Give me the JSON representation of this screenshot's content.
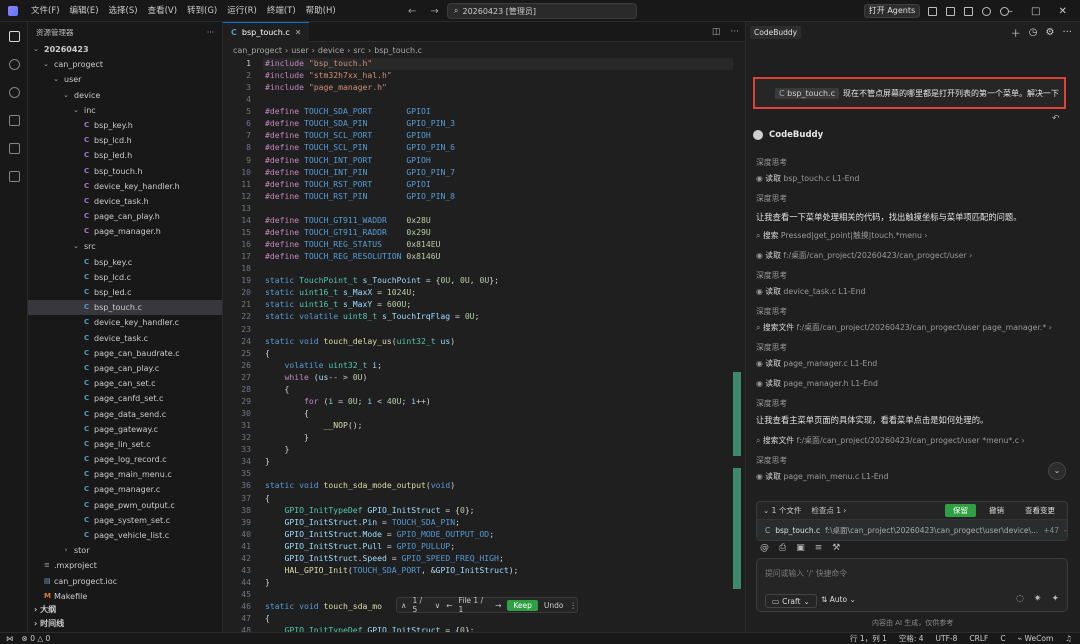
{
  "titlebar": {
    "menu": [
      "文件(F)",
      "编辑(E)",
      "选择(S)",
      "查看(V)",
      "转到(G)",
      "运行(R)",
      "终端(T)",
      "帮助(H)"
    ],
    "search": "20260423 [管理员]",
    "agents_button": "打开 Agents"
  },
  "explorer": {
    "title": "资源管理器",
    "more": "···",
    "tree": [
      {
        "label": "20260423",
        "depth": 0,
        "type": "folder-open",
        "bold": true
      },
      {
        "label": "can_progect",
        "depth": 1,
        "type": "folder-open"
      },
      {
        "label": "user",
        "depth": 2,
        "type": "folder-open"
      },
      {
        "label": "device",
        "depth": 3,
        "type": "folder-open"
      },
      {
        "label": "inc",
        "depth": 4,
        "type": "folder-open"
      },
      {
        "label": "bsp_key.h",
        "depth": 5,
        "type": "h"
      },
      {
        "label": "bsp_lcd.h",
        "depth": 5,
        "type": "h"
      },
      {
        "label": "bsp_led.h",
        "depth": 5,
        "type": "h"
      },
      {
        "label": "bsp_touch.h",
        "depth": 5,
        "type": "h"
      },
      {
        "label": "device_key_handler.h",
        "depth": 5,
        "type": "h"
      },
      {
        "label": "device_task.h",
        "depth": 5,
        "type": "h"
      },
      {
        "label": "page_can_play.h",
        "depth": 5,
        "type": "h"
      },
      {
        "label": "page_manager.h",
        "depth": 5,
        "type": "h"
      },
      {
        "label": "src",
        "depth": 4,
        "type": "folder-open"
      },
      {
        "label": "bsp_key.c",
        "depth": 5,
        "type": "c"
      },
      {
        "label": "bsp_lcd.c",
        "depth": 5,
        "type": "c"
      },
      {
        "label": "bsp_led.c",
        "depth": 5,
        "type": "c"
      },
      {
        "label": "bsp_touch.c",
        "depth": 5,
        "type": "c",
        "selected": true
      },
      {
        "label": "device_key_handler.c",
        "depth": 5,
        "type": "c"
      },
      {
        "label": "device_task.c",
        "depth": 5,
        "type": "c"
      },
      {
        "label": "page_can_baudrate.c",
        "depth": 5,
        "type": "c"
      },
      {
        "label": "page_can_play.c",
        "depth": 5,
        "type": "c"
      },
      {
        "label": "page_can_set.c",
        "depth": 5,
        "type": "c"
      },
      {
        "label": "page_canfd_set.c",
        "depth": 5,
        "type": "c"
      },
      {
        "label": "page_data_send.c",
        "depth": 5,
        "type": "c"
      },
      {
        "label": "page_gateway.c",
        "depth": 5,
        "type": "c"
      },
      {
        "label": "page_lin_set.c",
        "depth": 5,
        "type": "c"
      },
      {
        "label": "page_log_record.c",
        "depth": 5,
        "type": "c"
      },
      {
        "label": "page_main_menu.c",
        "depth": 5,
        "type": "c"
      },
      {
        "label": "page_manager.c",
        "depth": 5,
        "type": "c"
      },
      {
        "label": "page_pwm_output.c",
        "depth": 5,
        "type": "c"
      },
      {
        "label": "page_system_set.c",
        "depth": 5,
        "type": "c"
      },
      {
        "label": "page_vehicle_list.c",
        "depth": 5,
        "type": "c"
      },
      {
        "label": "stor",
        "depth": 3,
        "type": "folder-closed"
      },
      {
        "label": ".mxproject",
        "depth": 1,
        "type": "file"
      },
      {
        "label": "can_progect.ioc",
        "depth": 1,
        "type": "ioc"
      },
      {
        "label": "Makefile",
        "depth": 1,
        "type": "make"
      }
    ],
    "outline": "大纲",
    "timeline": "时间线"
  },
  "editor": {
    "tab": "bsp_touch.c",
    "breadcrumb": [
      "can_progect",
      "user",
      "device",
      "src",
      "bsp_touch.c"
    ],
    "lines": [
      [
        [
          "pp",
          "#include "
        ],
        [
          "str",
          "\"bsp_touch.h\""
        ]
      ],
      [
        [
          "pp",
          "#include "
        ],
        [
          "str",
          "\"stm32h7xx_hal.h\""
        ]
      ],
      [
        [
          "pp",
          "#include "
        ],
        [
          "str",
          "\"page_manager.h\""
        ]
      ],
      [],
      [
        [
          "pp",
          "#define "
        ],
        [
          "mac",
          "TOUCH_SDA_PORT       "
        ],
        [
          "mac",
          "GPIOI"
        ]
      ],
      [
        [
          "pp",
          "#define "
        ],
        [
          "mac",
          "TOUCH_SDA_PIN        "
        ],
        [
          "mac",
          "GPIO_PIN_3"
        ]
      ],
      [
        [
          "pp",
          "#define "
        ],
        [
          "mac",
          "TOUCH_SCL_PORT       "
        ],
        [
          "mac",
          "GPIOH"
        ]
      ],
      [
        [
          "pp",
          "#define "
        ],
        [
          "mac",
          "TOUCH_SCL_PIN        "
        ],
        [
          "mac",
          "GPIO_PIN_6"
        ]
      ],
      [
        [
          "pp",
          "#define "
        ],
        [
          "mac",
          "TOUCH_INT_PORT       "
        ],
        [
          "mac",
          "GPIOH"
        ]
      ],
      [
        [
          "pp",
          "#define "
        ],
        [
          "mac",
          "TOUCH_INT_PIN        "
        ],
        [
          "mac",
          "GPIO_PIN_7"
        ]
      ],
      [
        [
          "pp",
          "#define "
        ],
        [
          "mac",
          "TOUCH_RST_PORT       "
        ],
        [
          "mac",
          "GPIOI"
        ]
      ],
      [
        [
          "pp",
          "#define "
        ],
        [
          "mac",
          "TOUCH_RST_PIN        "
        ],
        [
          "mac",
          "GPIO_PIN_8"
        ]
      ],
      [],
      [
        [
          "pp",
          "#define "
        ],
        [
          "mac",
          "TOUCH_GT911_WADDR    "
        ],
        [
          "num",
          "0x28U"
        ]
      ],
      [
        [
          "pp",
          "#define "
        ],
        [
          "mac",
          "TOUCH_GT911_RADDR    "
        ],
        [
          "num",
          "0x29U"
        ]
      ],
      [
        [
          "pp",
          "#define "
        ],
        [
          "mac",
          "TOUCH_REG_STATUS     "
        ],
        [
          "num",
          "0x814EU"
        ]
      ],
      [
        [
          "pp",
          "#define "
        ],
        [
          "mac",
          "TOUCH_REG_RESOLUTION "
        ],
        [
          "num",
          "0x8146U"
        ]
      ],
      [],
      [
        [
          "kw",
          "static "
        ],
        [
          "ty",
          "TouchPoint_t "
        ],
        [
          "var",
          "s_TouchPoint"
        ],
        [
          "op",
          " = {"
        ],
        [
          "num",
          "0U"
        ],
        [
          "op",
          ", "
        ],
        [
          "num",
          "0U"
        ],
        [
          "op",
          ", "
        ],
        [
          "num",
          "0U"
        ],
        [
          "op",
          "};"
        ]
      ],
      [
        [
          "kw",
          "static "
        ],
        [
          "ty",
          "uint16_t "
        ],
        [
          "var",
          "s_MaxX"
        ],
        [
          "op",
          " = "
        ],
        [
          "num",
          "1024U"
        ],
        [
          "op",
          ";"
        ]
      ],
      [
        [
          "kw",
          "static "
        ],
        [
          "ty",
          "uint16_t "
        ],
        [
          "var",
          "s_MaxY"
        ],
        [
          "op",
          " = "
        ],
        [
          "num",
          "600U"
        ],
        [
          "op",
          ";"
        ]
      ],
      [
        [
          "kw",
          "static volatile "
        ],
        [
          "ty",
          "uint8_t "
        ],
        [
          "var",
          "s_TouchIrqFlag"
        ],
        [
          "op",
          " = "
        ],
        [
          "num",
          "0U"
        ],
        [
          "op",
          ";"
        ]
      ],
      [],
      [
        [
          "kw",
          "static void "
        ],
        [
          "fn",
          "touch_delay_us"
        ],
        [
          "op",
          "("
        ],
        [
          "ty",
          "uint32_t "
        ],
        [
          "var",
          "us"
        ],
        [
          "op",
          ")"
        ]
      ],
      [
        [
          "op",
          "{"
        ]
      ],
      [
        [
          "op",
          "    "
        ],
        [
          "kw",
          "volatile "
        ],
        [
          "ty",
          "uint32_t "
        ],
        [
          "var",
          "i"
        ],
        [
          "op",
          ";"
        ]
      ],
      [
        [
          "op",
          "    "
        ],
        [
          "pp",
          "while "
        ],
        [
          "op",
          "("
        ],
        [
          "var",
          "us"
        ],
        [
          "op",
          "-- > "
        ],
        [
          "num",
          "0U"
        ],
        [
          "op",
          ")"
        ]
      ],
      [
        [
          "op",
          "    {"
        ]
      ],
      [
        [
          "op",
          "        "
        ],
        [
          "pp",
          "for "
        ],
        [
          "op",
          "("
        ],
        [
          "var",
          "i"
        ],
        [
          "op",
          " = "
        ],
        [
          "num",
          "0U"
        ],
        [
          "op",
          "; "
        ],
        [
          "var",
          "i"
        ],
        [
          "op",
          " < "
        ],
        [
          "num",
          "40U"
        ],
        [
          "op",
          "; "
        ],
        [
          "var",
          "i"
        ],
        [
          "op",
          "++)"
        ]
      ],
      [
        [
          "op",
          "        {"
        ]
      ],
      [
        [
          "op",
          "            "
        ],
        [
          "fn",
          "__NOP"
        ],
        [
          "op",
          "();"
        ]
      ],
      [
        [
          "op",
          "        }"
        ]
      ],
      [
        [
          "op",
          "    }"
        ]
      ],
      [
        [
          "op",
          "}"
        ]
      ],
      [],
      [
        [
          "kw",
          "static void "
        ],
        [
          "fn",
          "touch_sda_mode_output"
        ],
        [
          "op",
          "("
        ],
        [
          "kw",
          "void"
        ],
        [
          "op",
          ")"
        ]
      ],
      [
        [
          "op",
          "{"
        ]
      ],
      [
        [
          "op",
          "    "
        ],
        [
          "ty",
          "GPIO_InitTypeDef "
        ],
        [
          "var",
          "GPIO_InitStruct"
        ],
        [
          "op",
          " = {"
        ],
        [
          "num",
          "0"
        ],
        [
          "op",
          "};"
        ]
      ],
      [
        [
          "op",
          "    "
        ],
        [
          "var",
          "GPIO_InitStruct"
        ],
        [
          "op",
          "."
        ],
        [
          "var",
          "Pin"
        ],
        [
          "op",
          " = "
        ],
        [
          "mac",
          "TOUCH_SDA_PIN"
        ],
        [
          "op",
          ";"
        ]
      ],
      [
        [
          "op",
          "    "
        ],
        [
          "var",
          "GPIO_InitStruct"
        ],
        [
          "op",
          "."
        ],
        [
          "var",
          "Mode"
        ],
        [
          "op",
          " = "
        ],
        [
          "mac",
          "GPIO_MODE_OUTPUT_OD"
        ],
        [
          "op",
          ";"
        ]
      ],
      [
        [
          "op",
          "    "
        ],
        [
          "var",
          "GPIO_InitStruct"
        ],
        [
          "op",
          "."
        ],
        [
          "var",
          "Pull"
        ],
        [
          "op",
          " = "
        ],
        [
          "mac",
          "GPIO_PULLUP"
        ],
        [
          "op",
          ";"
        ]
      ],
      [
        [
          "op",
          "    "
        ],
        [
          "var",
          "GPIO_InitStruct"
        ],
        [
          "op",
          "."
        ],
        [
          "var",
          "Speed"
        ],
        [
          "op",
          " = "
        ],
        [
          "mac",
          "GPIO_SPEED_FREQ_HIGH"
        ],
        [
          "op",
          ";"
        ]
      ],
      [
        [
          "op",
          "    "
        ],
        [
          "fn",
          "HAL_GPIO_Init"
        ],
        [
          "op",
          "("
        ],
        [
          "mac",
          "TOUCH_SDA_PORT"
        ],
        [
          "op",
          ", &"
        ],
        [
          "var",
          "GPIO_InitStruct"
        ],
        [
          "op",
          ");"
        ]
      ],
      [
        [
          "op",
          "}"
        ]
      ],
      [],
      [
        [
          "kw",
          "static void "
        ],
        [
          "fn",
          "touch_sda_mo"
        ]
      ],
      [
        [
          "op",
          "{"
        ]
      ],
      [
        [
          "op",
          "    "
        ],
        [
          "ty",
          "GPIO_InitTypeDef "
        ],
        [
          "var",
          "GPIO_InitStruct"
        ],
        [
          "op",
          " = {"
        ],
        [
          "num",
          "0"
        ],
        [
          "op",
          "};"
        ]
      ]
    ],
    "inline_actions": {
      "counter": "1 / 5",
      "file": "File 1 / 1",
      "keep": "Keep",
      "undo": "Undo"
    }
  },
  "chat": {
    "panel_title": "CodeBuddy",
    "user_file_chip": "bsp_touch.c",
    "user_message": "现在不管点屏幕的哪里都是打开列表的第一个菜单。解决一下",
    "assistant_name": "CodeBuddy",
    "items": [
      {
        "kind": "think",
        "text": "深度思考"
      },
      {
        "kind": "tool",
        "verb": "读取",
        "arg": "bsp_touch.c L1-End"
      },
      {
        "kind": "think",
        "text": "深度思考"
      },
      {
        "kind": "text",
        "text": "让我查看一下菜单处理相关的代码，找出触摸坐标与菜单项匹配的问题。"
      },
      {
        "kind": "tool",
        "verb": "搜索",
        "arg": "Pressed|get_point|触摸|touch.*menu"
      },
      {
        "kind": "tool",
        "verb": "读取",
        "arg": "f:/桌面/can_project/20260423/can_progect/user"
      },
      {
        "kind": "think",
        "text": "深度思考"
      },
      {
        "kind": "tool",
        "verb": "读取",
        "arg": "device_task.c L1-End"
      },
      {
        "kind": "think",
        "text": "深度思考"
      },
      {
        "kind": "tool",
        "verb": "搜索文件",
        "arg": "f:/桌面/can_project/20260423/can_progect/user page_manager.*"
      },
      {
        "kind": "think",
        "text": "深度思考"
      },
      {
        "kind": "tool",
        "verb": "读取",
        "arg": "page_manager.c L1-End"
      },
      {
        "kind": "tool",
        "verb": "读取",
        "arg": "page_manager.h L1-End"
      },
      {
        "kind": "think",
        "text": "深度思考"
      },
      {
        "kind": "text",
        "text": "让我查看主菜单页面的具体实现，看看菜单点击是如何处理的。"
      },
      {
        "kind": "tool",
        "verb": "搜索文件",
        "arg": "f:/桌面/can_project/20260423/can_progect/user *menu*.c"
      },
      {
        "kind": "think",
        "text": "深度思考"
      },
      {
        "kind": "tool",
        "verb": "读取",
        "arg": "page_main_menu.c L1-End"
      }
    ],
    "changes": {
      "summary": "1 个文件",
      "checkpoint": "检查点 1",
      "save": "保留",
      "undo": "撤销",
      "view": "查看变更",
      "file": "bsp_touch.c",
      "path": "f:\\桌面\\can_project\\20260423\\can_progect\\user\\device\\...",
      "added": "+47",
      "removed": "-4"
    },
    "input_placeholder": "提问或输入 '/' 快捷命令",
    "mode": "Craft",
    "model": "Auto",
    "ai_note": "内容由 AI 生成，仅供参考"
  },
  "statusbar": {
    "errors": "0",
    "warnings": "0",
    "position": "行 1，列 1",
    "spaces": "空格: 4",
    "encoding": "UTF-8",
    "eol": "CRLF",
    "language": "C",
    "user": "WeCom"
  }
}
